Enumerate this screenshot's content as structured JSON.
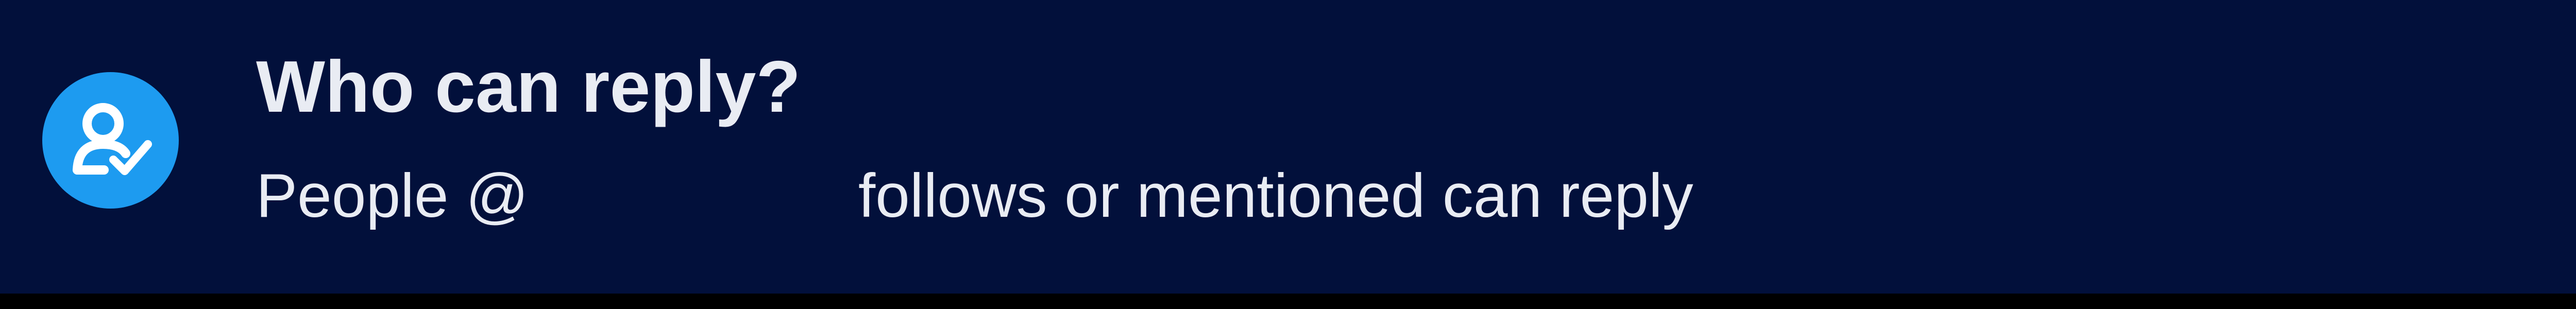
{
  "reply_notice": {
    "icon": "user-check-icon",
    "accent_color": "#1d9bf0",
    "background_color": "#02103b",
    "title": "Who can reply?",
    "description_prefix": "People @",
    "description_suffix": "follows or mentioned can reply"
  }
}
